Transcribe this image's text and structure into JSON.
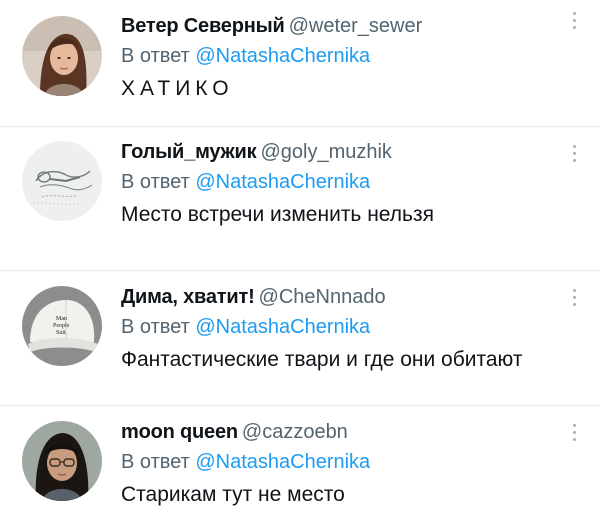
{
  "tweets": [
    {
      "name": "Ветер Северный",
      "handle": "@weter_sewer",
      "reply_prefix": "В ответ",
      "reply_to": "@NatashaChernika",
      "text": "ХАТИКО",
      "avatar": "woman-portrait-avatar"
    },
    {
      "name": "Голый_мужик",
      "handle": "@goly_muzhik",
      "reply_prefix": "В ответ",
      "reply_to": "@NatashaChernika",
      "text": "Место встречи изменить нельзя",
      "avatar": "sketch-figure-avatar"
    },
    {
      "name": "Дима, хватит!",
      "handle": "@CheNnnado",
      "reply_prefix": "В ответ",
      "reply_to": "@NatashaChernika",
      "text": "Фантастические твари и где они обитают",
      "avatar": "white-cap-avatar",
      "cap_text": "Man\nPeople\nSuit"
    },
    {
      "name": "moon queen",
      "handle": "@cazzoebn",
      "reply_prefix": "В ответ",
      "reply_to": "@NatashaChernika",
      "text": "Старикам тут не место",
      "avatar": "glasses-woman-avatar"
    }
  ],
  "colors": {
    "name": "#0f1419",
    "handle": "#536471",
    "mention": "#1d9bf0",
    "divider": "#e7eaee"
  }
}
